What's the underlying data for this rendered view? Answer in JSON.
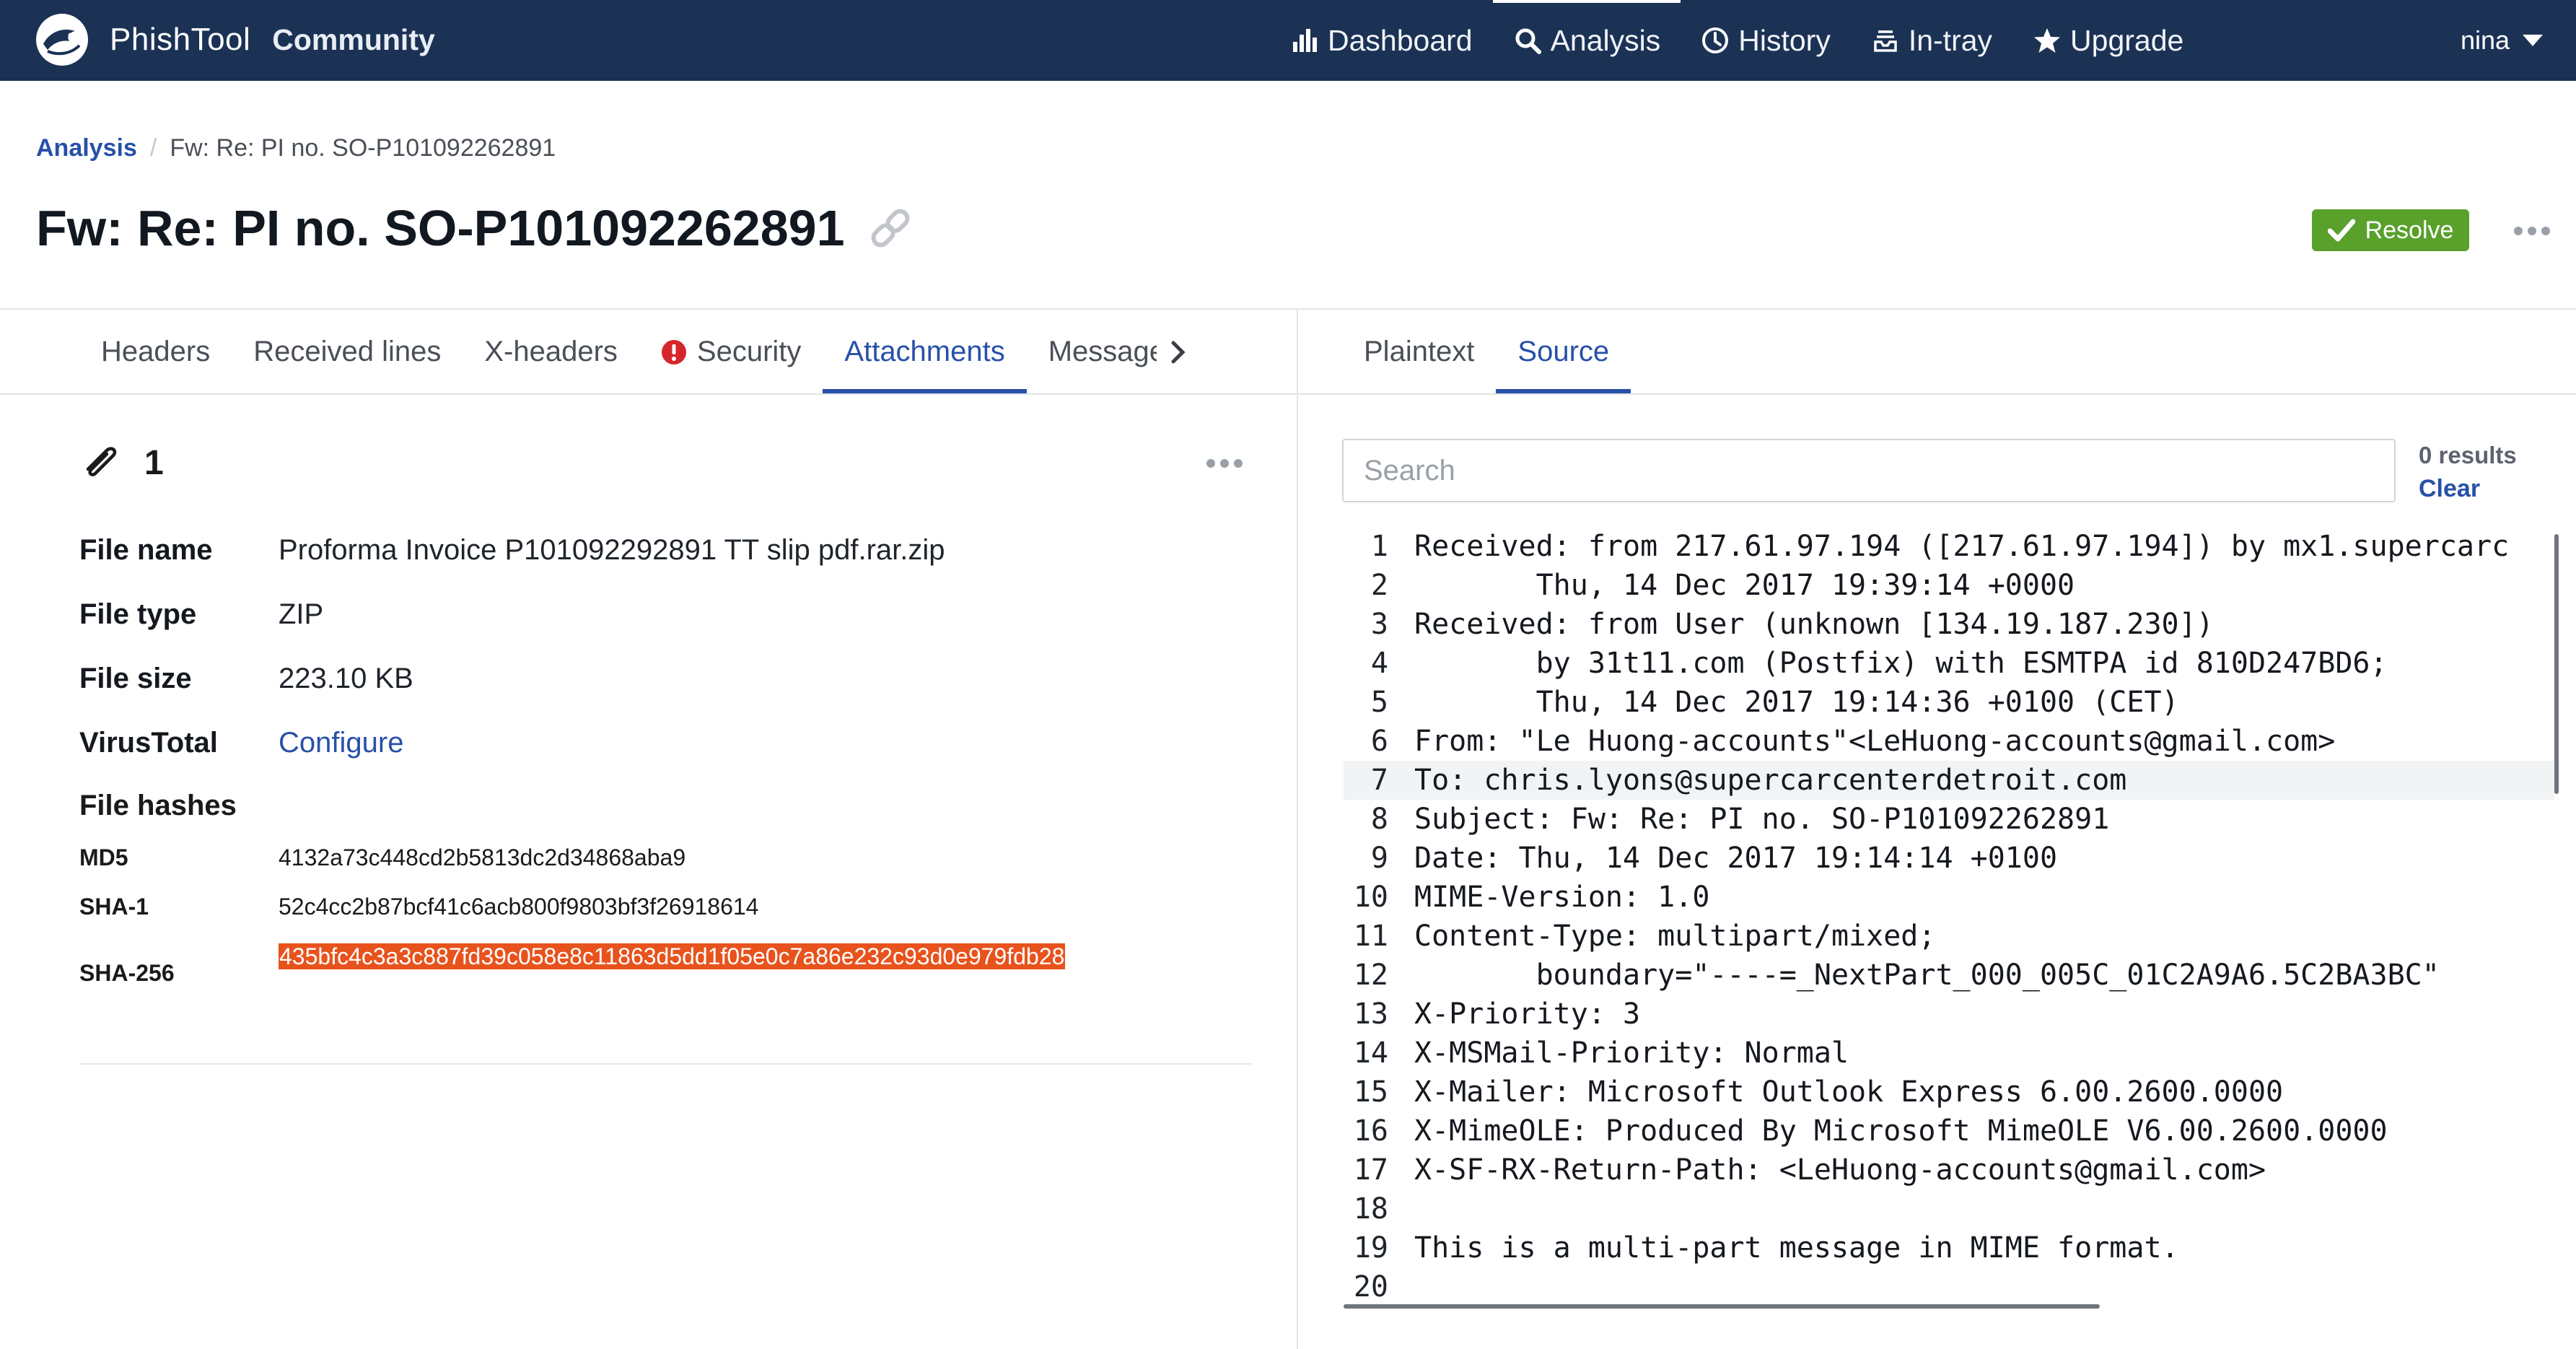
{
  "app": {
    "name": "PhishTool",
    "edition": "Community",
    "logo_icon": "phishtool-fish-logo"
  },
  "nav": {
    "items": [
      {
        "label": "Dashboard",
        "icon": "bar-chart-icon"
      },
      {
        "label": "Analysis",
        "icon": "search-icon",
        "active": true
      },
      {
        "label": "History",
        "icon": "clock-icon"
      },
      {
        "label": "In-tray",
        "icon": "inbox-tray-icon"
      },
      {
        "label": "Upgrade",
        "icon": "star-icon"
      }
    ],
    "user": "nina"
  },
  "breadcrumb": {
    "root": "Analysis",
    "separator": "/",
    "current": "Fw: Re: PI no. SO-P101092262891"
  },
  "page": {
    "title": "Fw: Re: PI no. SO-P101092262891",
    "resolve_label": "Resolve"
  },
  "left_tabs": [
    {
      "label": "Headers"
    },
    {
      "label": "Received lines"
    },
    {
      "label": "X-headers"
    },
    {
      "label": "Security",
      "icon": "alert-icon"
    },
    {
      "label": "Attachments",
      "active": true
    },
    {
      "label": "Message"
    }
  ],
  "right_tabs": [
    {
      "label": "Plaintext"
    },
    {
      "label": "Source",
      "active": true
    }
  ],
  "attachments": {
    "count": "1",
    "file_name_label": "File name",
    "file_name": "Proforma Invoice P101092292891 TT slip pdf.rar.zip",
    "file_type_label": "File type",
    "file_type": "ZIP",
    "file_size_label": "File size",
    "file_size": "223.10 KB",
    "virustotal_label": "VirusTotal",
    "virustotal_action": "Configure",
    "hashes_title": "File hashes",
    "md5_label": "MD5",
    "md5": "4132a73c448cd2b5813dc2d34868aba9",
    "sha1_label": "SHA-1",
    "sha1": "52c4cc2b87bcf41c6acb800f9803bf3f26918614",
    "sha256_label": "SHA-256",
    "sha256": "435bfc4c3a3c887fd39c058e8c11863d5dd1f05e0c7a86e232c93d0e979fdb28"
  },
  "source": {
    "search_placeholder": "Search",
    "results": "0 results",
    "clear_label": "Clear",
    "highlighted_line": 7,
    "lines": [
      "Received: from 217.61.97.194 ([217.61.97.194]) by mx1.supercarc",
      "       Thu, 14 Dec 2017 19:39:14 +0000",
      "Received: from User (unknown [134.19.187.230])",
      "       by 31t11.com (Postfix) with ESMTPA id 810D247BD6;",
      "       Thu, 14 Dec 2017 19:14:36 +0100 (CET)",
      "From: \"Le Huong-accounts\"<LeHuong-accounts@gmail.com>",
      "To: chris.lyons@supercarcenterdetroit.com",
      "Subject: Fw: Re: PI no. SO-P101092262891",
      "Date: Thu, 14 Dec 2017 19:14:14 +0100",
      "MIME-Version: 1.0",
      "Content-Type: multipart/mixed;",
      "       boundary=\"----=_NextPart_000_005C_01C2A9A6.5C2BA3BC\"",
      "X-Priority: 3",
      "X-MSMail-Priority: Normal",
      "X-Mailer: Microsoft Outlook Express 6.00.2600.0000",
      "X-MimeOLE: Produced By Microsoft MimeOLE V6.00.2600.0000",
      "X-SF-RX-Return-Path: <LeHuong-accounts@gmail.com>",
      "",
      "This is a multi-part message in MIME format.",
      ""
    ]
  },
  "colors": {
    "topbar": "#1b3255",
    "accent": "#2750a8",
    "resolve": "#5aa12c",
    "hash_highlight": "#e8531d",
    "alert": "#d7262b"
  }
}
